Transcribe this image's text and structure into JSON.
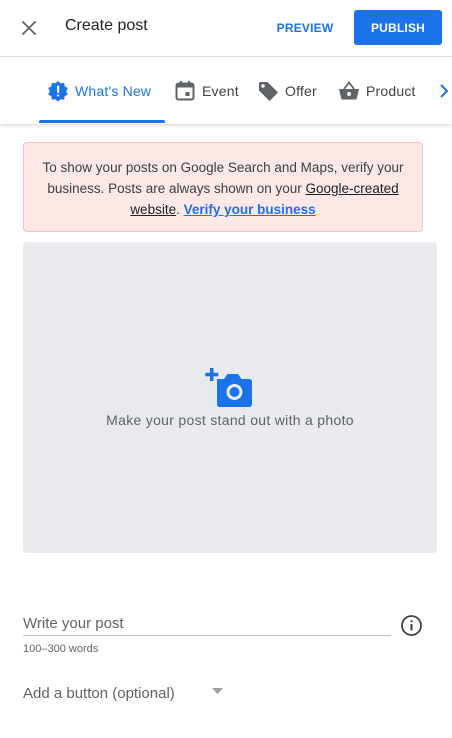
{
  "header": {
    "title": "Create post",
    "preview_label": "PREVIEW",
    "publish_label": "PUBLISH"
  },
  "tabs": [
    {
      "label": "What's New",
      "icon": "alert-badge-icon",
      "active": true
    },
    {
      "label": "Event",
      "icon": "calendar-icon",
      "active": false
    },
    {
      "label": "Offer",
      "icon": "tag-icon",
      "active": false
    },
    {
      "label": "Product",
      "icon": "basket-icon",
      "active": false
    }
  ],
  "alert": {
    "text_before": "To show your posts on Google Search and Maps, verify your business. Posts are always shown on your ",
    "site_link": "Google-created website",
    "text_after": ". ",
    "verify_link": "Verify your business"
  },
  "photo": {
    "prompt": "Make your post stand out with a photo",
    "icon": "add-photo-icon"
  },
  "post": {
    "placeholder": "Write your post",
    "hint": "100–300 words"
  },
  "cta": {
    "placeholder": "Add a button (optional)"
  },
  "colors": {
    "accent": "#1a73e8",
    "alert_bg": "#fce8e6",
    "photo_bg": "#e8eaed"
  }
}
